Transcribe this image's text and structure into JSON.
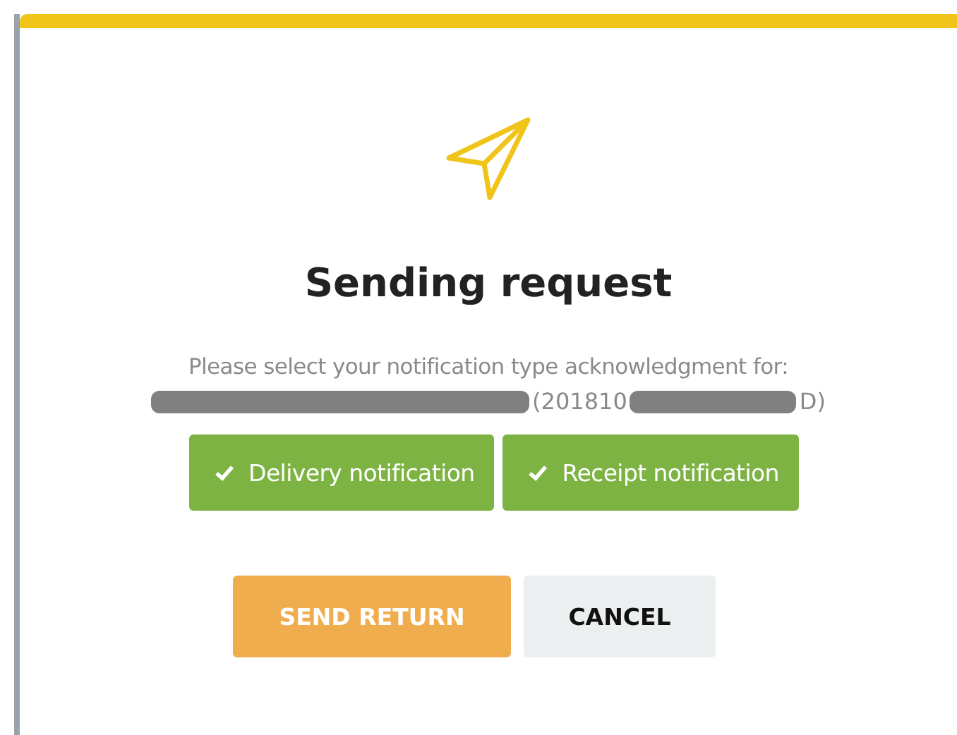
{
  "dialog": {
    "title": "Sending request",
    "message": "Please select your notification type acknowledgment for:",
    "reference": {
      "visible_parts": [
        "(201810",
        "D)"
      ]
    },
    "notification_options": [
      {
        "label": "Delivery notification",
        "checked": true
      },
      {
        "label": "Receipt notification",
        "checked": true
      }
    ],
    "buttons": [
      {
        "label": "SEND RETURN",
        "kind": "primary"
      },
      {
        "label": "CANCEL",
        "kind": "secondary"
      }
    ]
  }
}
